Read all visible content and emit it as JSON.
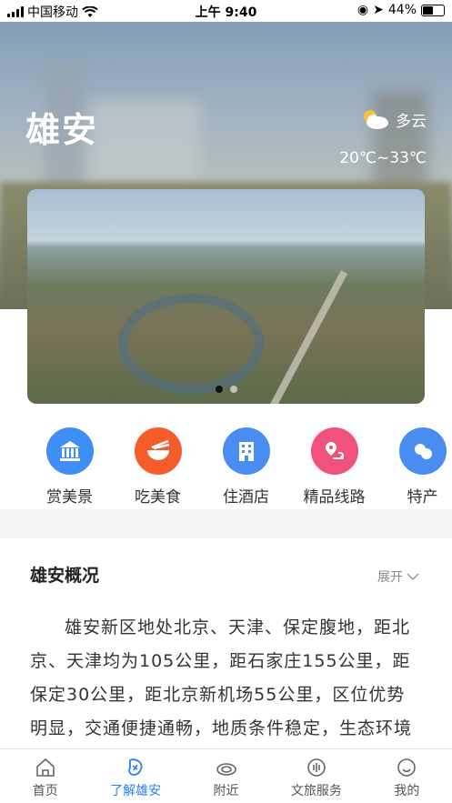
{
  "status_bar": {
    "carrier": "中国移动",
    "time": "上午 9:40",
    "battery": "44%"
  },
  "hero": {
    "city": "雄安",
    "weather_icon": "partly-cloudy-icon",
    "weather_text": "多云",
    "temperature": "20℃~33℃"
  },
  "banner": {
    "slides": 2,
    "active_slide": 1
  },
  "categories": [
    {
      "label": "赏美景",
      "icon": "museum-icon",
      "color": "#3f8ef5"
    },
    {
      "label": "吃美食",
      "icon": "bowl-icon",
      "color": "#f45d2b"
    },
    {
      "label": "住酒店",
      "icon": "hotel-icon",
      "color": "#4a8df2"
    },
    {
      "label": "精品线路",
      "icon": "route-icon",
      "color": "#f0527d"
    },
    {
      "label": "特产",
      "icon": "specialty-icon",
      "color": "#4a8df2"
    }
  ],
  "overview": {
    "title": "雄安概况",
    "expand_label": "展开",
    "text": "雄安新区地处北京、天津、保定腹地，距北京、天津均为105公里，距石家庄155公里，距保定30公里，距北京新机场55公里，区位优势明显，交通便捷通畅，地质条件稳定，生态环境优良，资源环境承载能力较强"
  },
  "tabbar": [
    {
      "label": "首页",
      "icon": "home-icon",
      "active": false
    },
    {
      "label": "了解雄安",
      "icon": "explore-icon",
      "active": true
    },
    {
      "label": "附近",
      "icon": "nearby-icon",
      "active": false
    },
    {
      "label": "文旅服务",
      "icon": "service-icon",
      "active": false
    },
    {
      "label": "我的",
      "icon": "profile-icon",
      "active": false
    }
  ],
  "colors": {
    "accent": "#2a7cf6"
  }
}
